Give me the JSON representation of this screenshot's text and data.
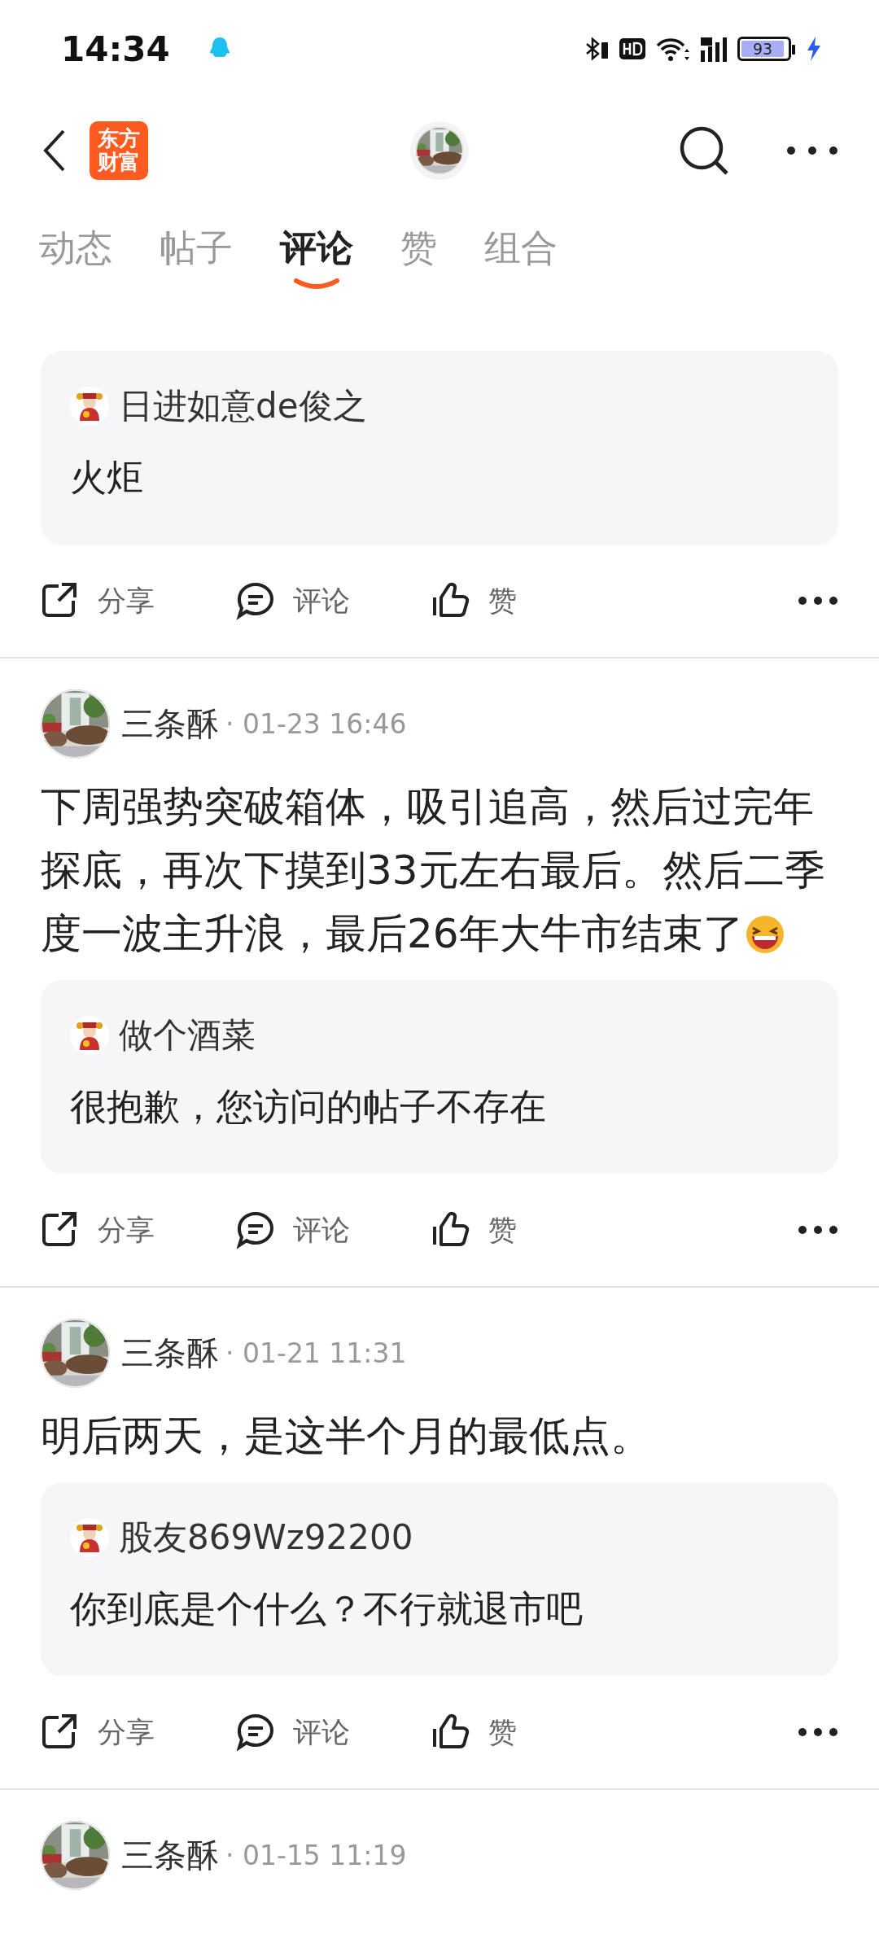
{
  "status_bar": {
    "time": "14:34",
    "battery": "93"
  },
  "header": {
    "logo": [
      "东方",
      "财富"
    ]
  },
  "tabs": [
    {
      "label": "动态",
      "selected": false
    },
    {
      "label": "帖子",
      "selected": false
    },
    {
      "label": "评论",
      "selected": true
    },
    {
      "label": "赞",
      "selected": false
    },
    {
      "label": "组合",
      "selected": false
    }
  ],
  "posts": [
    {
      "reply": {
        "author": "日进如意de俊之",
        "text": "火炬"
      },
      "actions": [
        "分享",
        "评论",
        "赞"
      ]
    },
    {
      "author": "三条酥",
      "time": "· 01-23 16:46",
      "text": "下周强势突破箱体，吸引追高，然后过完年探底，再次下摸到33元左右最后。然后二季度一波主升浪，最后26年大牛市结束了",
      "emoji": true,
      "reply": {
        "author": "做个酒菜",
        "text": "很抱歉，您访问的帖子不存在"
      },
      "actions": [
        "分享",
        "评论",
        "赞"
      ]
    },
    {
      "author": "三条酥",
      "time": "· 01-21 11:31",
      "text": "明后两天，是这半个月的最低点。",
      "emoji": false,
      "reply": {
        "author": "股友869Wz92200",
        "text": "你到底是个什么？不行就退市吧"
      },
      "actions": [
        "分享",
        "评论",
        "赞"
      ]
    },
    {
      "author": "三条酥",
      "time": "· 01-15 11:19"
    }
  ]
}
